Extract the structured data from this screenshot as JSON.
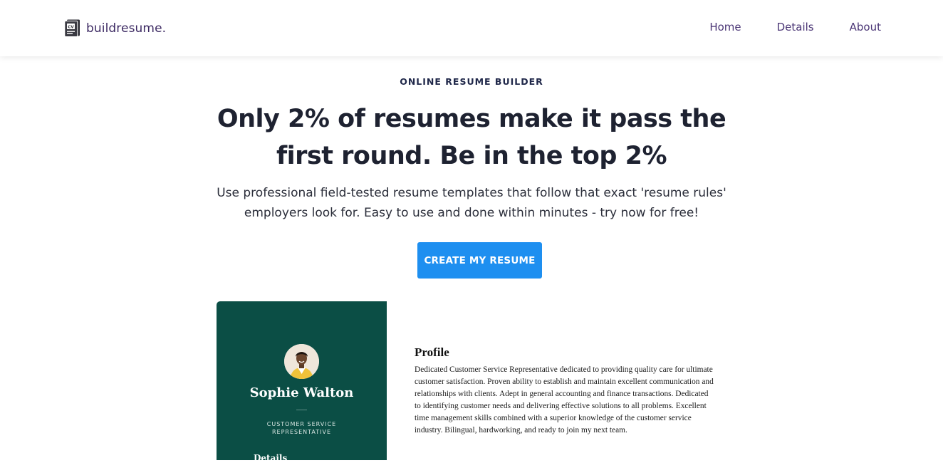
{
  "nav": {
    "brand": "buildresume.",
    "logo_icon": "cv-document-icon",
    "links": [
      "Home",
      "Details",
      "About"
    ]
  },
  "hero": {
    "eyebrow": "ONLINE RESUME BUILDER",
    "headline": "Only 2% of resumes make it pass the first round. Be in the top 2%",
    "subtitle": "Use professional field-tested resume templates that follow that exact 'resume rules' employers look for. Easy to use and done within minutes - try now for free!",
    "cta_label": "CREATE MY RESUME"
  },
  "resume_preview": {
    "name": "Sophie Walton",
    "role": "CUSTOMER SERVICE REPRESENTATIVE",
    "details_heading": "Details",
    "profile_heading": "Profile",
    "profile_text": "Dedicated Customer Service Representative dedicated to providing quality care for ultimate customer satisfaction. Proven ability to establish and maintain excellent communication and relationships with clients. Adept in general accounting and finance transactions. Dedicated to identifying customer needs and delivering effective solutions to all problems. Excellent time management skills combined with a superior knowledge of the customer service industry. Bilingual, hardworking, and ready to join my next team."
  },
  "colors": {
    "brand_text": "#3d2a63",
    "cta": "#1e8ff0",
    "sidebar": "#0b4e45",
    "headline": "#1e2231"
  }
}
